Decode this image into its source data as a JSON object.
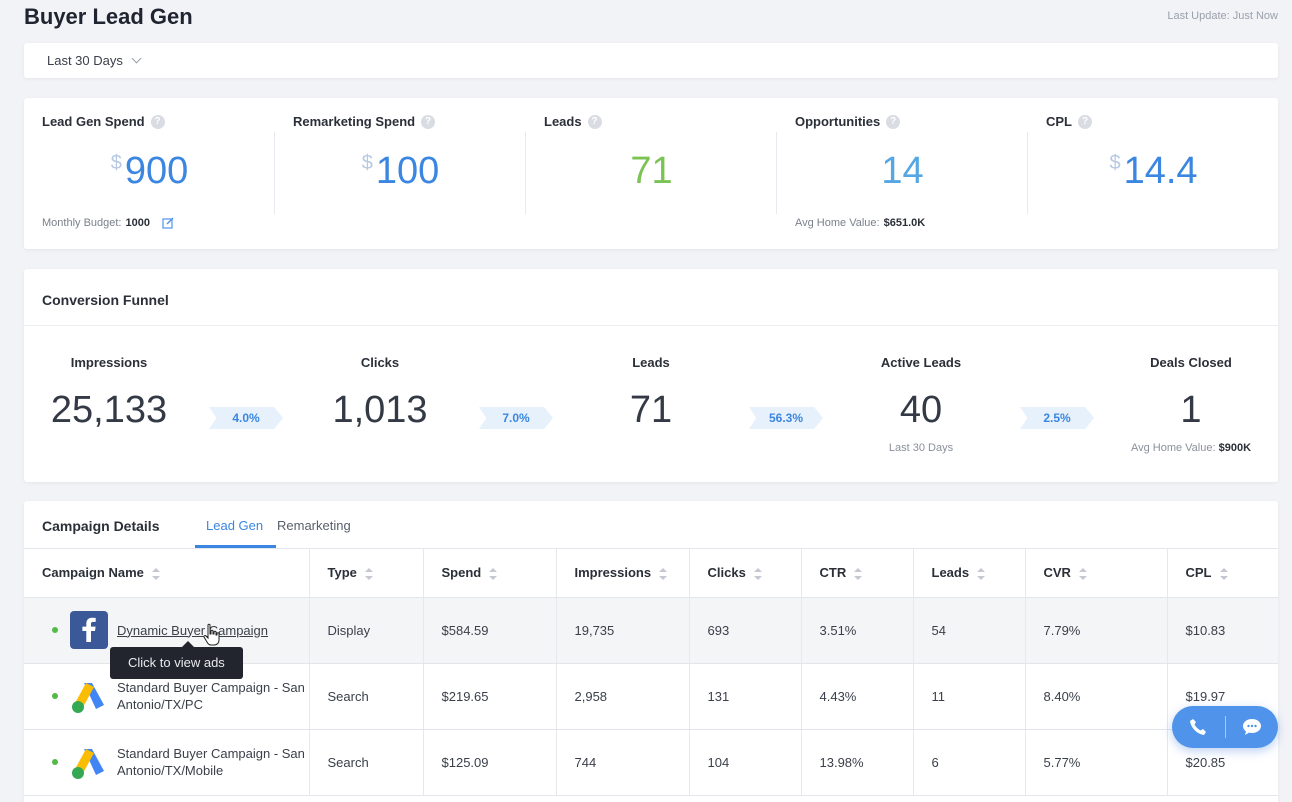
{
  "header": {
    "title": "Buyer Lead Gen",
    "last_update": "Last Update: Just Now"
  },
  "filter": {
    "date_range": "Last 30 Days"
  },
  "kpis": [
    {
      "label": "Lead Gen Spend",
      "currency": "$",
      "value": "900",
      "foot_label": "Monthly Budget:",
      "foot_value": "1000"
    },
    {
      "label": "Remarketing Spend",
      "currency": "$",
      "value": "100"
    },
    {
      "label": "Leads",
      "value": "71"
    },
    {
      "label": "Opportunities",
      "value": "14",
      "foot_label": "Avg Home Value:",
      "foot_value": "$651.0K"
    },
    {
      "label": "CPL",
      "currency": "$",
      "value": "14.4"
    }
  ],
  "funnel": {
    "title": "Conversion Funnel",
    "stages": [
      {
        "label": "Impressions",
        "value": "25,133"
      },
      {
        "label": "Clicks",
        "value": "1,013"
      },
      {
        "label": "Leads",
        "value": "71"
      },
      {
        "label": "Active Leads",
        "value": "40",
        "sub": "Last 30 Days"
      },
      {
        "label": "Deals Closed",
        "value": "1",
        "sub_label": "Avg Home Value:",
        "sub_value": "$900K"
      }
    ],
    "rates": [
      "4.0%",
      "7.0%",
      "56.3%",
      "2.5%"
    ]
  },
  "campaigns": {
    "title": "Campaign Details",
    "tabs": [
      "Lead Gen",
      "Remarketing"
    ],
    "active_tab": "Lead Gen",
    "columns": [
      "Campaign Name",
      "Type",
      "Spend",
      "Impressions",
      "Clicks",
      "CTR",
      "Leads",
      "CVR",
      "CPL"
    ],
    "rows": [
      {
        "platform": "facebook-icon",
        "name": "Dynamic Buyer Campaign",
        "type": "Display",
        "spend": "$584.59",
        "impressions": "19,735",
        "clicks": "693",
        "ctr": "3.51%",
        "leads": "54",
        "cvr": "7.79%",
        "cpl": "$10.83"
      },
      {
        "platform": "google-ads-icon",
        "name": "Standard Buyer Campaign - San Antonio/TX/PC",
        "type": "Search",
        "spend": "$219.65",
        "impressions": "2,958",
        "clicks": "131",
        "ctr": "4.43%",
        "leads": "11",
        "cvr": "8.40%",
        "cpl": "$19.97"
      },
      {
        "platform": "google-ads-icon",
        "name": "Standard Buyer Campaign - San Antonio/TX/Mobile",
        "type": "Search",
        "spend": "$125.09",
        "impressions": "744",
        "clicks": "104",
        "ctr": "13.98%",
        "leads": "6",
        "cvr": "5.77%",
        "cpl": "$20.85"
      }
    ],
    "tooltip": "Click to view ads"
  },
  "colors": {
    "accent": "#3a86e0",
    "leads_green": "#7cc356",
    "opportunities_blue": "#55a7e3",
    "status_dot": "#54b948",
    "facebook": "#3b5998"
  }
}
